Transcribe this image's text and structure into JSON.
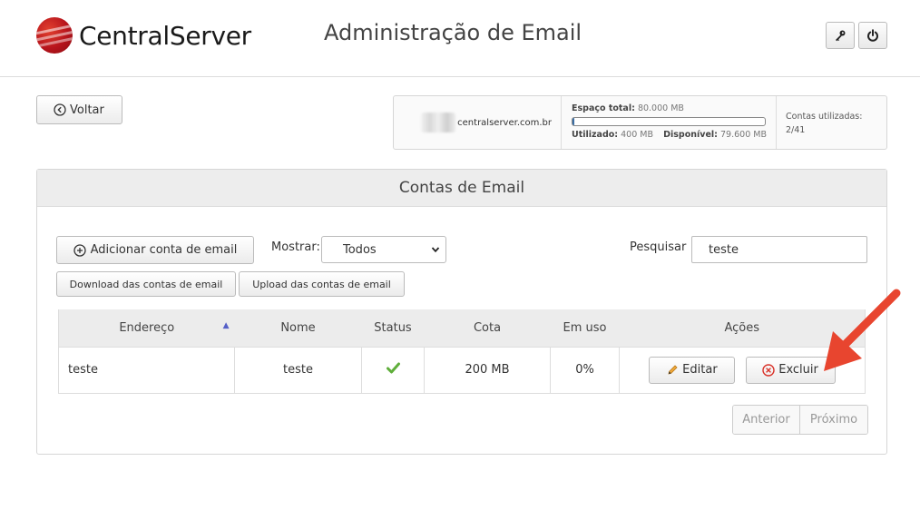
{
  "header": {
    "brand": "CentralServer",
    "title": "Administração de Email"
  },
  "nav": {
    "back_label": "Voltar"
  },
  "quota": {
    "domain": "centralserver.com.br",
    "total_label": "Espaço total:",
    "total_value": "80.000 MB",
    "used_label": "Utilizado:",
    "used_value": "400 MB",
    "free_label": "Disponível:",
    "free_value": "79.600 MB",
    "usage_fraction": 0.005,
    "accounts_label": "Contas utilizadas:",
    "accounts_value": "2/41",
    "bar_color": "#3a6ea5"
  },
  "panel": {
    "title": "Contas de Email",
    "add_label": "Adicionar conta de email",
    "download_label": "Download das contas de email",
    "upload_label": "Upload das contas de email",
    "show_label": "Mostrar:",
    "show_selected": "Todos",
    "search_label": "Pesquisar",
    "search_value": "teste"
  },
  "table": {
    "headers": [
      "Endereço",
      "Nome",
      "Status",
      "Cota",
      "Em uso",
      "Ações"
    ],
    "rows": [
      {
        "address": "teste",
        "name": "teste",
        "status_icon": "check-icon",
        "quota": "200 MB",
        "usage": "0%",
        "edit_label": "Editar",
        "delete_label": "Excluir"
      }
    ]
  },
  "pager": {
    "prev_label": "Anterior",
    "next_label": "Próximo"
  },
  "annotation": {
    "arrow_color": "#e8452f"
  }
}
